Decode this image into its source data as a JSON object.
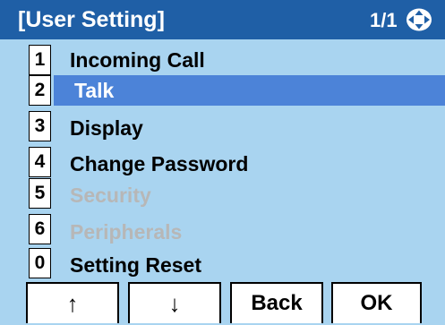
{
  "header": {
    "title": "[User Setting]",
    "page": "1/1",
    "nav_icon": "four-way-nav-icon",
    "bg_color": "#1f5fa6"
  },
  "menu": {
    "items": [
      {
        "number": "1",
        "label": "Incoming Call",
        "state": "normal"
      },
      {
        "number": "2",
        "label": "Talk",
        "state": "selected"
      },
      {
        "number": "3",
        "label": "Display",
        "state": "normal"
      },
      {
        "number": "4",
        "label": "Change Password",
        "state": "normal"
      },
      {
        "number": "5",
        "label": "Security",
        "state": "disabled"
      },
      {
        "number": "6",
        "label": "Peripherals",
        "state": "disabled"
      },
      {
        "number": "0",
        "label": "Setting Reset",
        "state": "normal"
      }
    ],
    "selected_color": "#4c83d8",
    "disabled_color": "#b7b7b7",
    "background": "#a9d4f0"
  },
  "softkeys": {
    "up": "↑",
    "down": "↓",
    "back": "Back",
    "ok": "OK"
  }
}
